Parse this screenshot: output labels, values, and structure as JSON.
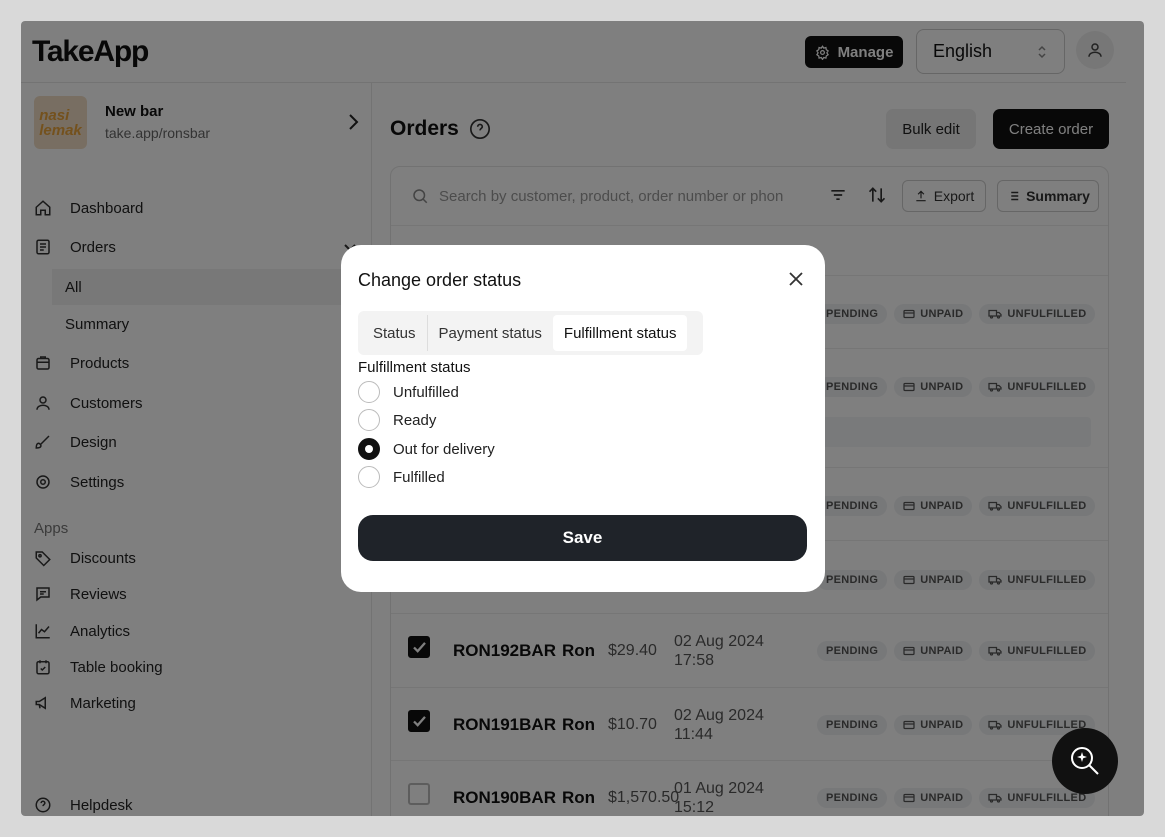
{
  "header": {
    "logo": "TakeApp",
    "manage_label": "Manage",
    "language": "English"
  },
  "sidebar": {
    "store_name": "New bar",
    "store_url": "take.app/ronsbar",
    "store_logo_text": "nasi lemak",
    "items": [
      {
        "label": "Dashboard",
        "icon": "home-icon"
      },
      {
        "label": "Orders",
        "icon": "orders-icon"
      },
      {
        "label": "Products",
        "icon": "products-icon"
      },
      {
        "label": "Customers",
        "icon": "user-icon"
      },
      {
        "label": "Design",
        "icon": "brush-icon"
      },
      {
        "label": "Settings",
        "icon": "gear-icon"
      }
    ],
    "orders_sub": [
      {
        "label": "All",
        "active": true
      },
      {
        "label": "Summary",
        "active": false
      }
    ],
    "apps_heading": "Apps",
    "apps": [
      {
        "label": "Discounts",
        "icon": "tag-icon"
      },
      {
        "label": "Reviews",
        "icon": "review-icon"
      },
      {
        "label": "Analytics",
        "icon": "chart-icon"
      },
      {
        "label": "Table booking",
        "icon": "calendar-icon"
      },
      {
        "label": "Marketing",
        "icon": "megaphone-icon"
      }
    ],
    "helpdesk": "Helpdesk"
  },
  "main": {
    "title": "Orders",
    "bulk_edit": "Bulk edit",
    "create_order": "Create order",
    "search_placeholder": "Search by customer, product, order number or phon",
    "export": "Export",
    "summary": "Summary",
    "badges": {
      "status": "PENDING",
      "payment": "UNPAID",
      "fulfillment": "UNFULFILLED"
    },
    "orders": [
      {
        "number": "RON192BAR",
        "customer": "Ron",
        "amount": "$29.40",
        "date": "02 Aug 2024",
        "time": "17:58",
        "checked": true
      },
      {
        "number": "RON191BAR",
        "customer": "Ron",
        "amount": "$10.70",
        "date": "02 Aug 2024",
        "time": "11:44",
        "checked": true
      },
      {
        "number": "RON190BAR",
        "customer": "Ron",
        "amount": "$1,570.50",
        "date": "01 Aug 2024",
        "time": "15:12",
        "checked": false
      }
    ]
  },
  "modal": {
    "title": "Change order status",
    "tabs": [
      {
        "label": "Status",
        "active": false
      },
      {
        "label": "Payment status",
        "active": false
      },
      {
        "label": "Fulfillment status",
        "active": true
      }
    ],
    "group_label": "Fulfillment status",
    "options": [
      {
        "label": "Unfulfilled",
        "checked": false
      },
      {
        "label": "Ready",
        "checked": false
      },
      {
        "label": "Out for delivery",
        "checked": true
      },
      {
        "label": "Fulfilled",
        "checked": false
      }
    ],
    "save": "Save"
  },
  "colors": {
    "primary": "#111111",
    "save_button": "#1f2329",
    "overlay": "rgba(0,0,0,0.5)"
  }
}
